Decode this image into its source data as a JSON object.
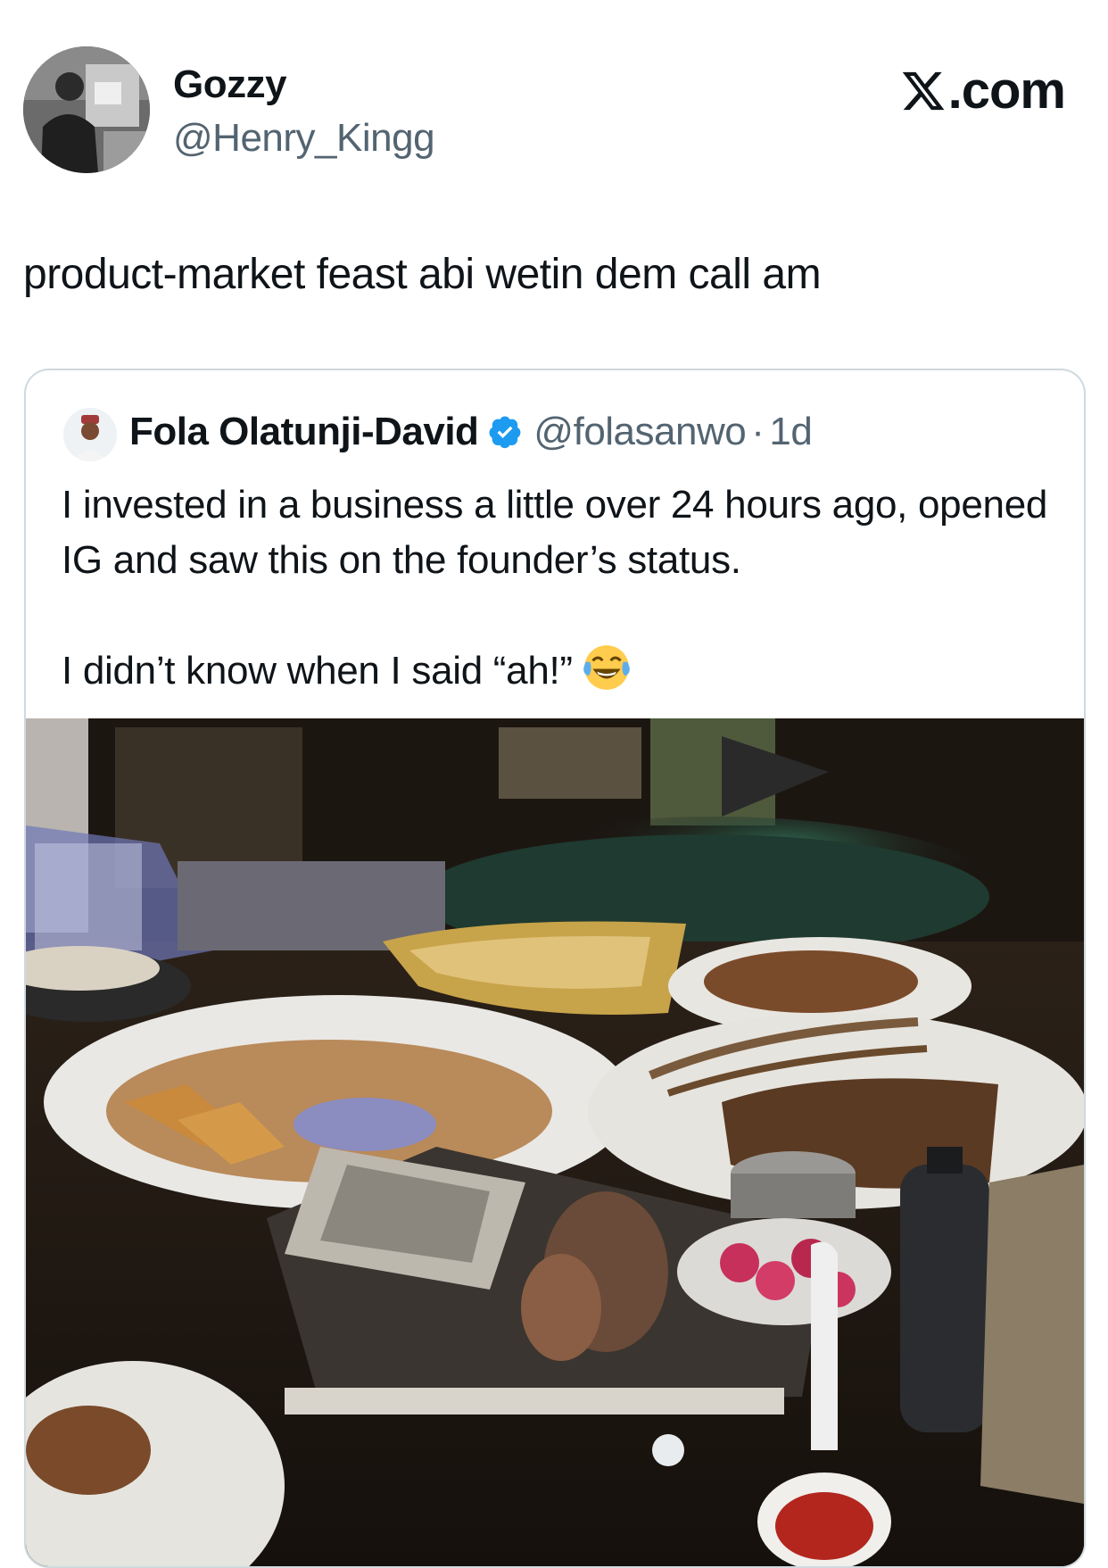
{
  "tweet": {
    "author_name": "Gozzy",
    "author_handle": "@Henry_Kingg",
    "brand": ".com",
    "text": "product-market feast abi wetin dem call am",
    "avatar_icon": "profile-photo"
  },
  "quoted_tweet": {
    "author_name": "Fola Olatunji-David",
    "verified": true,
    "author_handle": "@folasanwo",
    "separator": "·",
    "time": "1d",
    "line1": "I invested in a business a little over 24 hours ago, opened IG and saw this on the founder’s status.",
    "line2": "I didn’t know when I said “ah!”",
    "emoji_icon": "face-with-tears-of-joy-icon",
    "media_icon": "photo-of-restaurant-table-with-leftover-food",
    "colors": {
      "verified_blue": "#1d9bf0",
      "secondary_text": "#536471",
      "border": "#cfd9de"
    }
  }
}
